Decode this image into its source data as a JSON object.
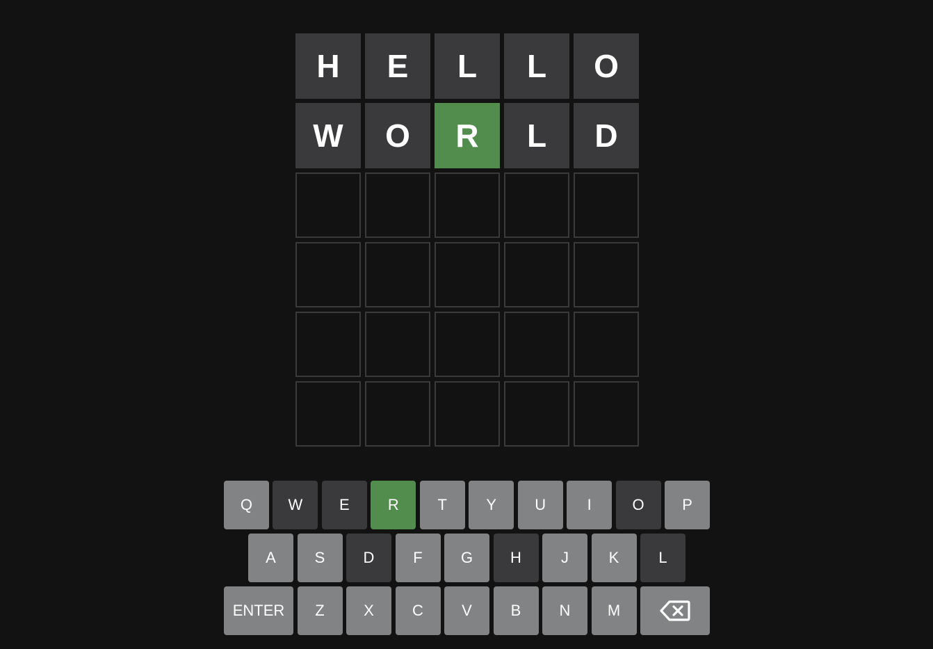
{
  "board": {
    "rows": [
      [
        {
          "letter": "H",
          "state": "absent"
        },
        {
          "letter": "E",
          "state": "absent"
        },
        {
          "letter": "L",
          "state": "absent"
        },
        {
          "letter": "L",
          "state": "absent"
        },
        {
          "letter": "O",
          "state": "absent"
        }
      ],
      [
        {
          "letter": "W",
          "state": "absent"
        },
        {
          "letter": "O",
          "state": "absent"
        },
        {
          "letter": "R",
          "state": "correct"
        },
        {
          "letter": "L",
          "state": "absent"
        },
        {
          "letter": "D",
          "state": "absent"
        }
      ],
      [
        {
          "letter": "",
          "state": "empty"
        },
        {
          "letter": "",
          "state": "empty"
        },
        {
          "letter": "",
          "state": "empty"
        },
        {
          "letter": "",
          "state": "empty"
        },
        {
          "letter": "",
          "state": "empty"
        }
      ],
      [
        {
          "letter": "",
          "state": "empty"
        },
        {
          "letter": "",
          "state": "empty"
        },
        {
          "letter": "",
          "state": "empty"
        },
        {
          "letter": "",
          "state": "empty"
        },
        {
          "letter": "",
          "state": "empty"
        }
      ],
      [
        {
          "letter": "",
          "state": "empty"
        },
        {
          "letter": "",
          "state": "empty"
        },
        {
          "letter": "",
          "state": "empty"
        },
        {
          "letter": "",
          "state": "empty"
        },
        {
          "letter": "",
          "state": "empty"
        }
      ],
      [
        {
          "letter": "",
          "state": "empty"
        },
        {
          "letter": "",
          "state": "empty"
        },
        {
          "letter": "",
          "state": "empty"
        },
        {
          "letter": "",
          "state": "empty"
        },
        {
          "letter": "",
          "state": "empty"
        }
      ]
    ]
  },
  "keyboard": {
    "rows": [
      [
        {
          "label": "Q",
          "state": "unused"
        },
        {
          "label": "W",
          "state": "absent"
        },
        {
          "label": "E",
          "state": "absent"
        },
        {
          "label": "R",
          "state": "correct"
        },
        {
          "label": "T",
          "state": "unused"
        },
        {
          "label": "Y",
          "state": "unused"
        },
        {
          "label": "U",
          "state": "unused"
        },
        {
          "label": "I",
          "state": "unused"
        },
        {
          "label": "O",
          "state": "absent"
        },
        {
          "label": "P",
          "state": "unused"
        }
      ],
      [
        {
          "label": "A",
          "state": "unused"
        },
        {
          "label": "S",
          "state": "unused"
        },
        {
          "label": "D",
          "state": "absent"
        },
        {
          "label": "F",
          "state": "unused"
        },
        {
          "label": "G",
          "state": "unused"
        },
        {
          "label": "H",
          "state": "absent"
        },
        {
          "label": "J",
          "state": "unused"
        },
        {
          "label": "K",
          "state": "unused"
        },
        {
          "label": "L",
          "state": "absent"
        }
      ],
      [
        {
          "label": "ENTER",
          "state": "unused",
          "wide": true
        },
        {
          "label": "Z",
          "state": "unused"
        },
        {
          "label": "X",
          "state": "unused"
        },
        {
          "label": "C",
          "state": "unused"
        },
        {
          "label": "V",
          "state": "unused"
        },
        {
          "label": "B",
          "state": "unused"
        },
        {
          "label": "N",
          "state": "unused"
        },
        {
          "label": "M",
          "state": "unused"
        },
        {
          "label": "",
          "icon": "backspace-icon",
          "state": "unused",
          "wide": true
        }
      ]
    ]
  },
  "colors": {
    "background": "#121213",
    "absent": "#3a3a3c",
    "correct": "#538d4e",
    "present": "#b59f3b",
    "key_unused": "#818384",
    "empty_border": "#3a3a3c"
  }
}
